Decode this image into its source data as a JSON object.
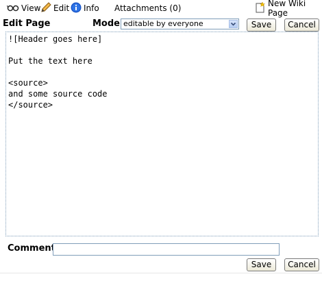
{
  "toolbar": {
    "view_label": "View",
    "edit_label": "Edit",
    "info_label": "Info",
    "attachments_label": "Attachments (0)",
    "new_page_label": "New Wiki Page",
    "icons": [
      "glasses-icon",
      "pencil-icon",
      "info-icon",
      "new-page-icon"
    ]
  },
  "edit": {
    "title": "Edit Page",
    "mode_label": "Mode:",
    "mode_value": "editable by everyone",
    "save_label": "Save",
    "cancel_label": "Cancel"
  },
  "editor": {
    "content": "![Header goes here]\n\nPut the text here\n\n<source>\nand some source code\n</source>"
  },
  "comment": {
    "label": "Comment:",
    "value": "",
    "save_label": "Save",
    "cancel_label": "Cancel"
  },
  "colors": {
    "accent": "#1a56c8",
    "border": "#7f9db9"
  }
}
